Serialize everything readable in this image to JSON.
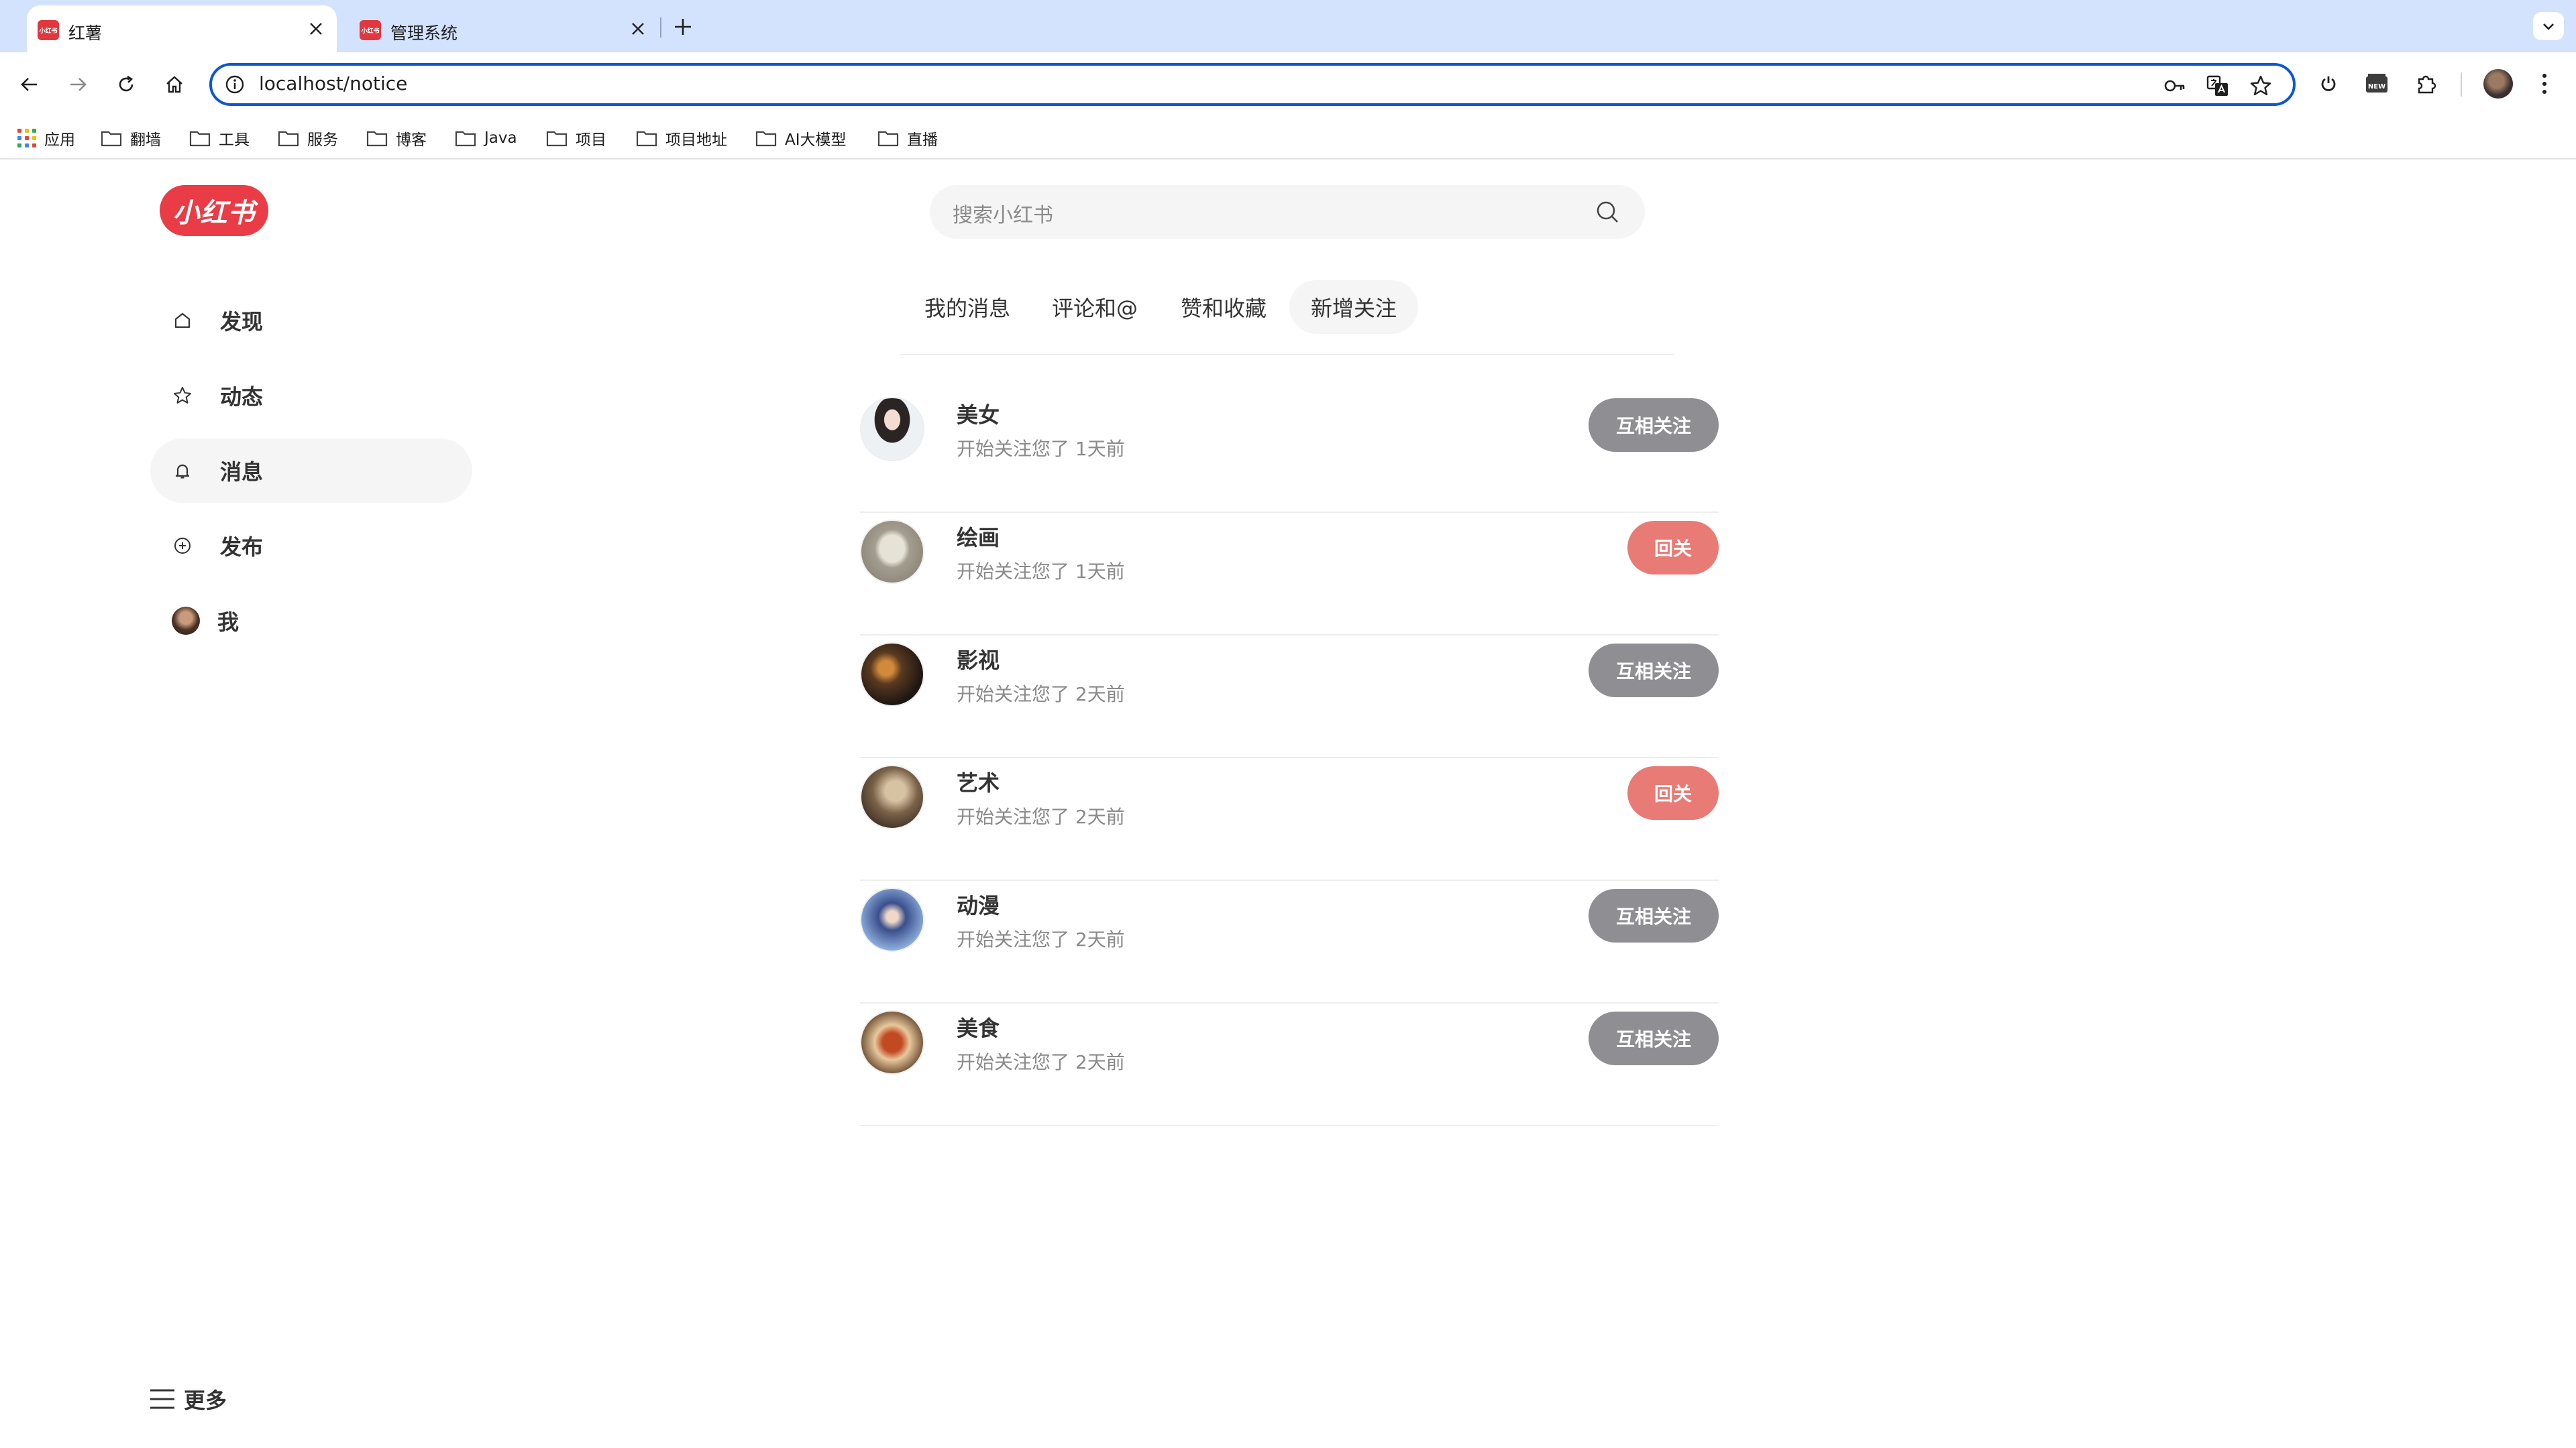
{
  "browser": {
    "tabs": [
      {
        "title": "红薯",
        "favicon": "小红书",
        "active": true
      },
      {
        "title": "管理系统",
        "favicon": "小红书",
        "active": false
      }
    ],
    "url": "localhost/notice",
    "bookmarks": [
      "应用",
      "翻墙",
      "工具",
      "服务",
      "博客",
      "Java",
      "项目",
      "项目地址",
      "AI大模型",
      "直播"
    ]
  },
  "app": {
    "logo": "小红书",
    "search_placeholder": "搜索小红书",
    "nav": [
      {
        "label": "发现",
        "icon": "home-icon",
        "active": false
      },
      {
        "label": "动态",
        "icon": "star-icon",
        "active": false
      },
      {
        "label": "消息",
        "icon": "bell-icon",
        "active": true
      },
      {
        "label": "发布",
        "icon": "plus-circle-icon",
        "active": false
      },
      {
        "label": "我",
        "icon": "avatar",
        "active": false
      }
    ],
    "more": "更多",
    "notice_tabs": [
      {
        "label": "我的消息",
        "active": false
      },
      {
        "label": "评论和@",
        "active": false
      },
      {
        "label": "赞和收藏",
        "active": false
      },
      {
        "label": "新增关注",
        "active": true
      }
    ],
    "followers": [
      {
        "name": "美女",
        "subtitle": "开始关注您了 1天前",
        "button": "互相关注",
        "button_type": "mutual"
      },
      {
        "name": "绘画",
        "subtitle": "开始关注您了 1天前",
        "button": "回关",
        "button_type": "follow-back"
      },
      {
        "name": "影视",
        "subtitle": "开始关注您了 2天前",
        "button": "互相关注",
        "button_type": "mutual"
      },
      {
        "name": "艺术",
        "subtitle": "开始关注您了 2天前",
        "button": "回关",
        "button_type": "follow-back"
      },
      {
        "name": "动漫",
        "subtitle": "开始关注您了 2天前",
        "button": "互相关注",
        "button_type": "mutual"
      },
      {
        "name": "美食",
        "subtitle": "开始关注您了 2天前",
        "button": "互相关注",
        "button_type": "mutual"
      }
    ]
  },
  "colors": {
    "brand": "#ea3c46",
    "mutual_button": "#8e8e93",
    "follow_back_button": "#e87b76",
    "tabstrip": "#d3e3fd",
    "omnibox_border": "#0b57d0"
  }
}
